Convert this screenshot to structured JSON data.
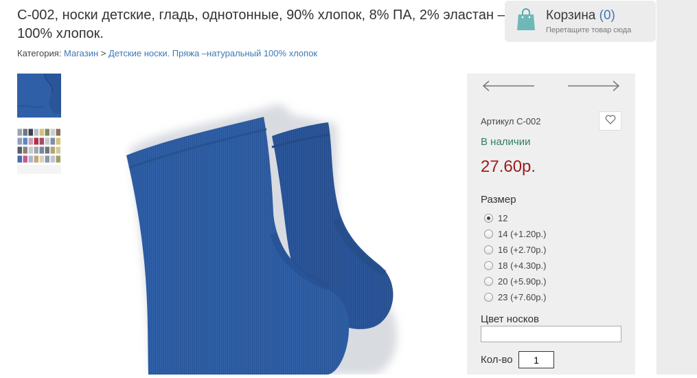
{
  "product": {
    "title": "С-002, носки детские, гладь, однотонные, 90% хлопок, 8% ПА, 2% эластан – 100% хлопок."
  },
  "breadcrumb": {
    "label": "Категория:",
    "items": [
      "Магазин",
      "Детские носки. Пряжа –натуральный 100% хлопок"
    ],
    "separator": ">"
  },
  "cart": {
    "title": "Корзина",
    "count": "(0)",
    "hint": "Перетащите товар сюда",
    "icon": "shopping-bag-icon",
    "icon_color": "#6fb8b8"
  },
  "gallery": {
    "thumbnail_1": "blue-sock-thumbnail",
    "thumbnail_2": "color-palette-thumbnail",
    "main_image": "blue-socks-photo",
    "sock_color": "#2f5fa6"
  },
  "buy_panel": {
    "prev_icon": "arrow-left-icon",
    "next_icon": "arrow-right-icon",
    "sku": "Артикул С-002",
    "favorite_icon": "heart-icon",
    "stock": "В наличии",
    "price": "27.60р.",
    "size_label": "Размер",
    "sizes": [
      {
        "label": "12",
        "selected": true
      },
      {
        "label": "14 (+1.20р.)",
        "selected": false
      },
      {
        "label": "16 (+2.70р.)",
        "selected": false
      },
      {
        "label": "18 (+4.30р.)",
        "selected": false
      },
      {
        "label": "20 (+5.90р.)",
        "selected": false
      },
      {
        "label": "23 (+7.60р.)",
        "selected": false
      }
    ],
    "color_label": "Цвет носков",
    "color_value": "",
    "qty_label": "Кол-во",
    "qty_value": "1"
  },
  "colors": {
    "link": "#3d78b5",
    "price": "#9b1c1c",
    "stock": "#2f7c6a",
    "panel_bg": "#efefef"
  }
}
